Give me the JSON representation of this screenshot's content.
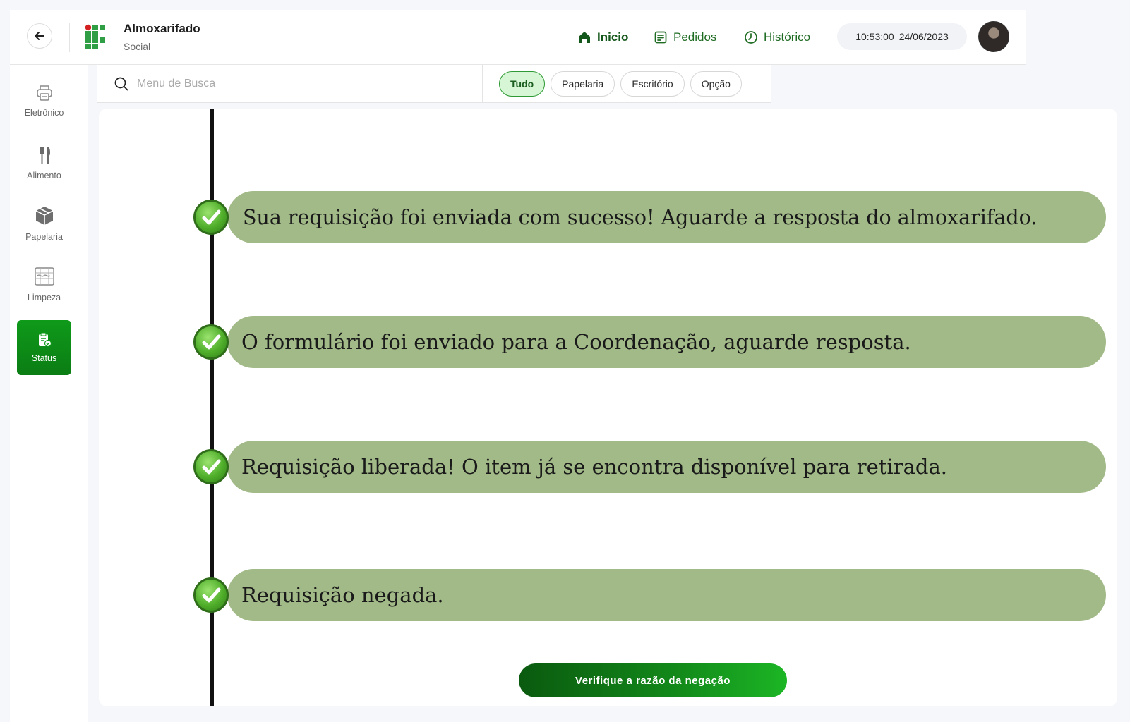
{
  "header": {
    "brand_title": "Almoxarifado",
    "brand_subtitle": "Social",
    "nav": [
      {
        "label": "Inicio",
        "icon": "home-icon",
        "active": true
      },
      {
        "label": "Pedidos",
        "icon": "document-icon",
        "active": false
      },
      {
        "label": "Histórico",
        "icon": "clock-icon",
        "active": false
      }
    ],
    "time": "10:53:00",
    "date": "24/06/2023"
  },
  "sidebar": {
    "items": [
      {
        "label": "Eletrônico",
        "icon": "printer-icon",
        "active": false
      },
      {
        "label": "Alimento",
        "icon": "cutlery-icon",
        "active": false
      },
      {
        "label": "Papelaria",
        "icon": "box-icon",
        "active": false
      },
      {
        "label": "Limpeza",
        "icon": "cleaning-icon",
        "active": false
      },
      {
        "label": "Status",
        "icon": "status-clipboard-icon",
        "active": true
      }
    ]
  },
  "search": {
    "placeholder": "Menu de Busca",
    "value": ""
  },
  "filters": [
    {
      "label": "Tudo",
      "active": true
    },
    {
      "label": "Papelaria",
      "active": false
    },
    {
      "label": "Escritório",
      "active": false
    },
    {
      "label": "Opção",
      "active": false
    }
  ],
  "timeline": [
    {
      "text": "Sua requisição foi enviada com sucesso! Aguarde a resposta do almoxarifado.",
      "status": "checked"
    },
    {
      "text": "O formulário foi enviado para a Coordenação, aguarde resposta.",
      "status": "checked"
    },
    {
      "text": "Requisição liberada! O item já se encontra disponível para retirada.",
      "status": "checked"
    },
    {
      "text": "Requisição negada.",
      "status": "checked"
    }
  ],
  "action": {
    "label": "Verifique a razão da negação"
  },
  "colors": {
    "accent": "#14571a",
    "pill": "#a2ba88",
    "active_side": "#0f9a1a",
    "chip_active": "#d6f6d6"
  }
}
